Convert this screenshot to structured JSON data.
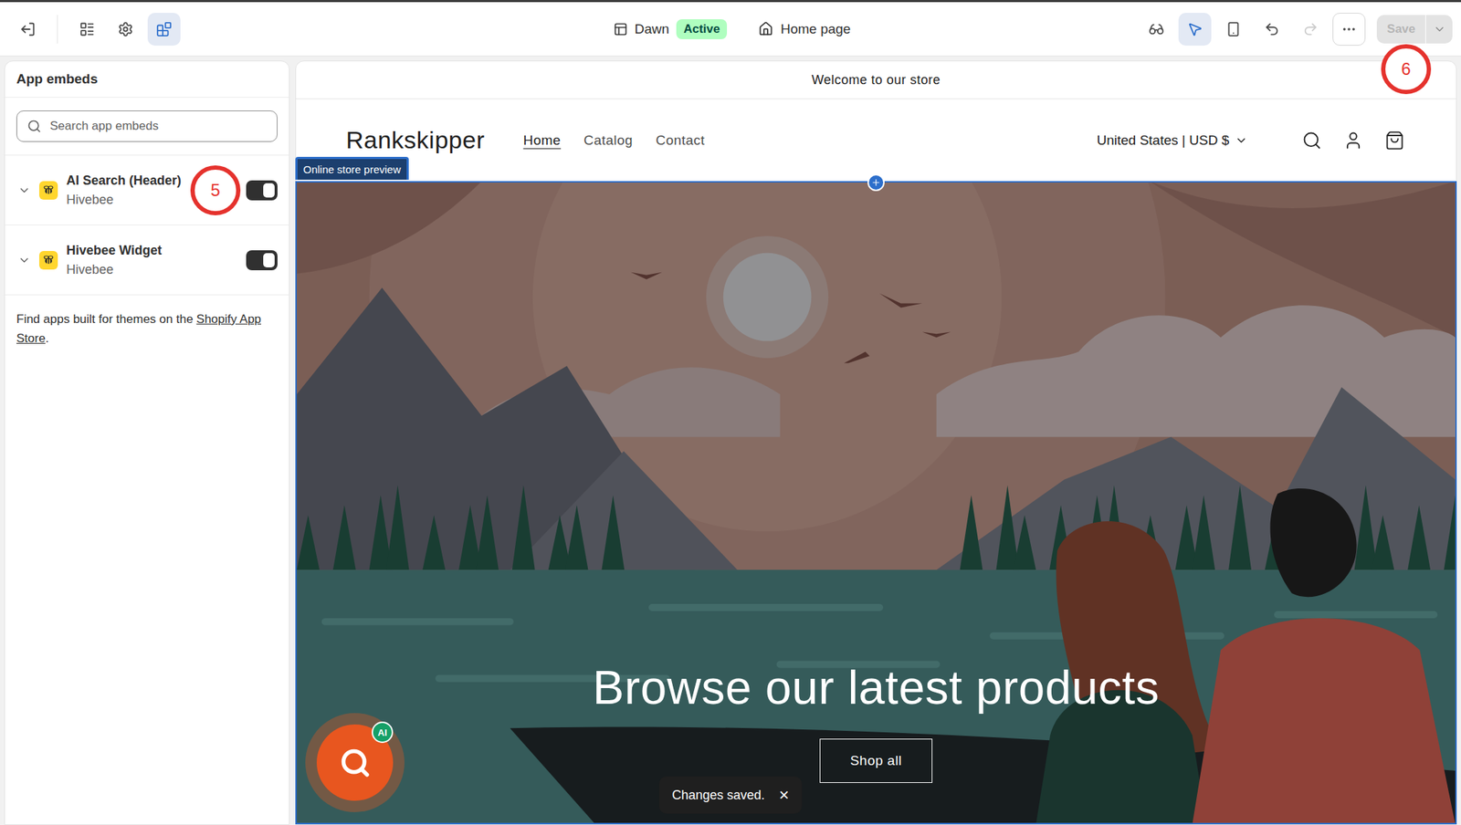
{
  "topbar": {
    "tools": [
      {
        "selected": false
      },
      {
        "selected": false
      },
      {
        "selected": true
      }
    ],
    "theme": {
      "name": "Dawn",
      "status": "Active"
    },
    "page": "Home page",
    "view_tools": [
      {
        "selected": false
      },
      {
        "selected": true
      },
      {
        "selected": false
      }
    ],
    "undo": {
      "disabled": false
    },
    "redo": {
      "disabled": true
    },
    "save": {
      "label": "Save",
      "disabled": true,
      "annotation": "6"
    }
  },
  "sidebar": {
    "title": "App embeds",
    "search": {
      "placeholder": "Search app embeds"
    },
    "embeds": [
      {
        "name": "AI Search (Header)",
        "provider": "Hivebee",
        "enabled": true,
        "expanded": false,
        "annotation": "5"
      },
      {
        "name": "Hivebee Widget",
        "provider": "Hivebee",
        "enabled": true,
        "expanded": false,
        "annotation": ""
      }
    ],
    "footer": {
      "text": "Find apps built for themes on the ",
      "link": "Shopify App Store",
      "end": "."
    }
  },
  "preview": {
    "label": "Online store preview",
    "announcement": "Welcome to our store",
    "logo": "Rankskipper",
    "nav": [
      {
        "label": "Home",
        "selected": true
      },
      {
        "label": "Catalog",
        "selected": false
      },
      {
        "label": "Contact",
        "selected": false
      }
    ],
    "locale": "United States | USD $",
    "hero": {
      "heading": "Browse our latest products",
      "button": "Shop all"
    },
    "search_badge": "AI"
  },
  "toast": {
    "message": "Changes saved.",
    "close": "×"
  }
}
